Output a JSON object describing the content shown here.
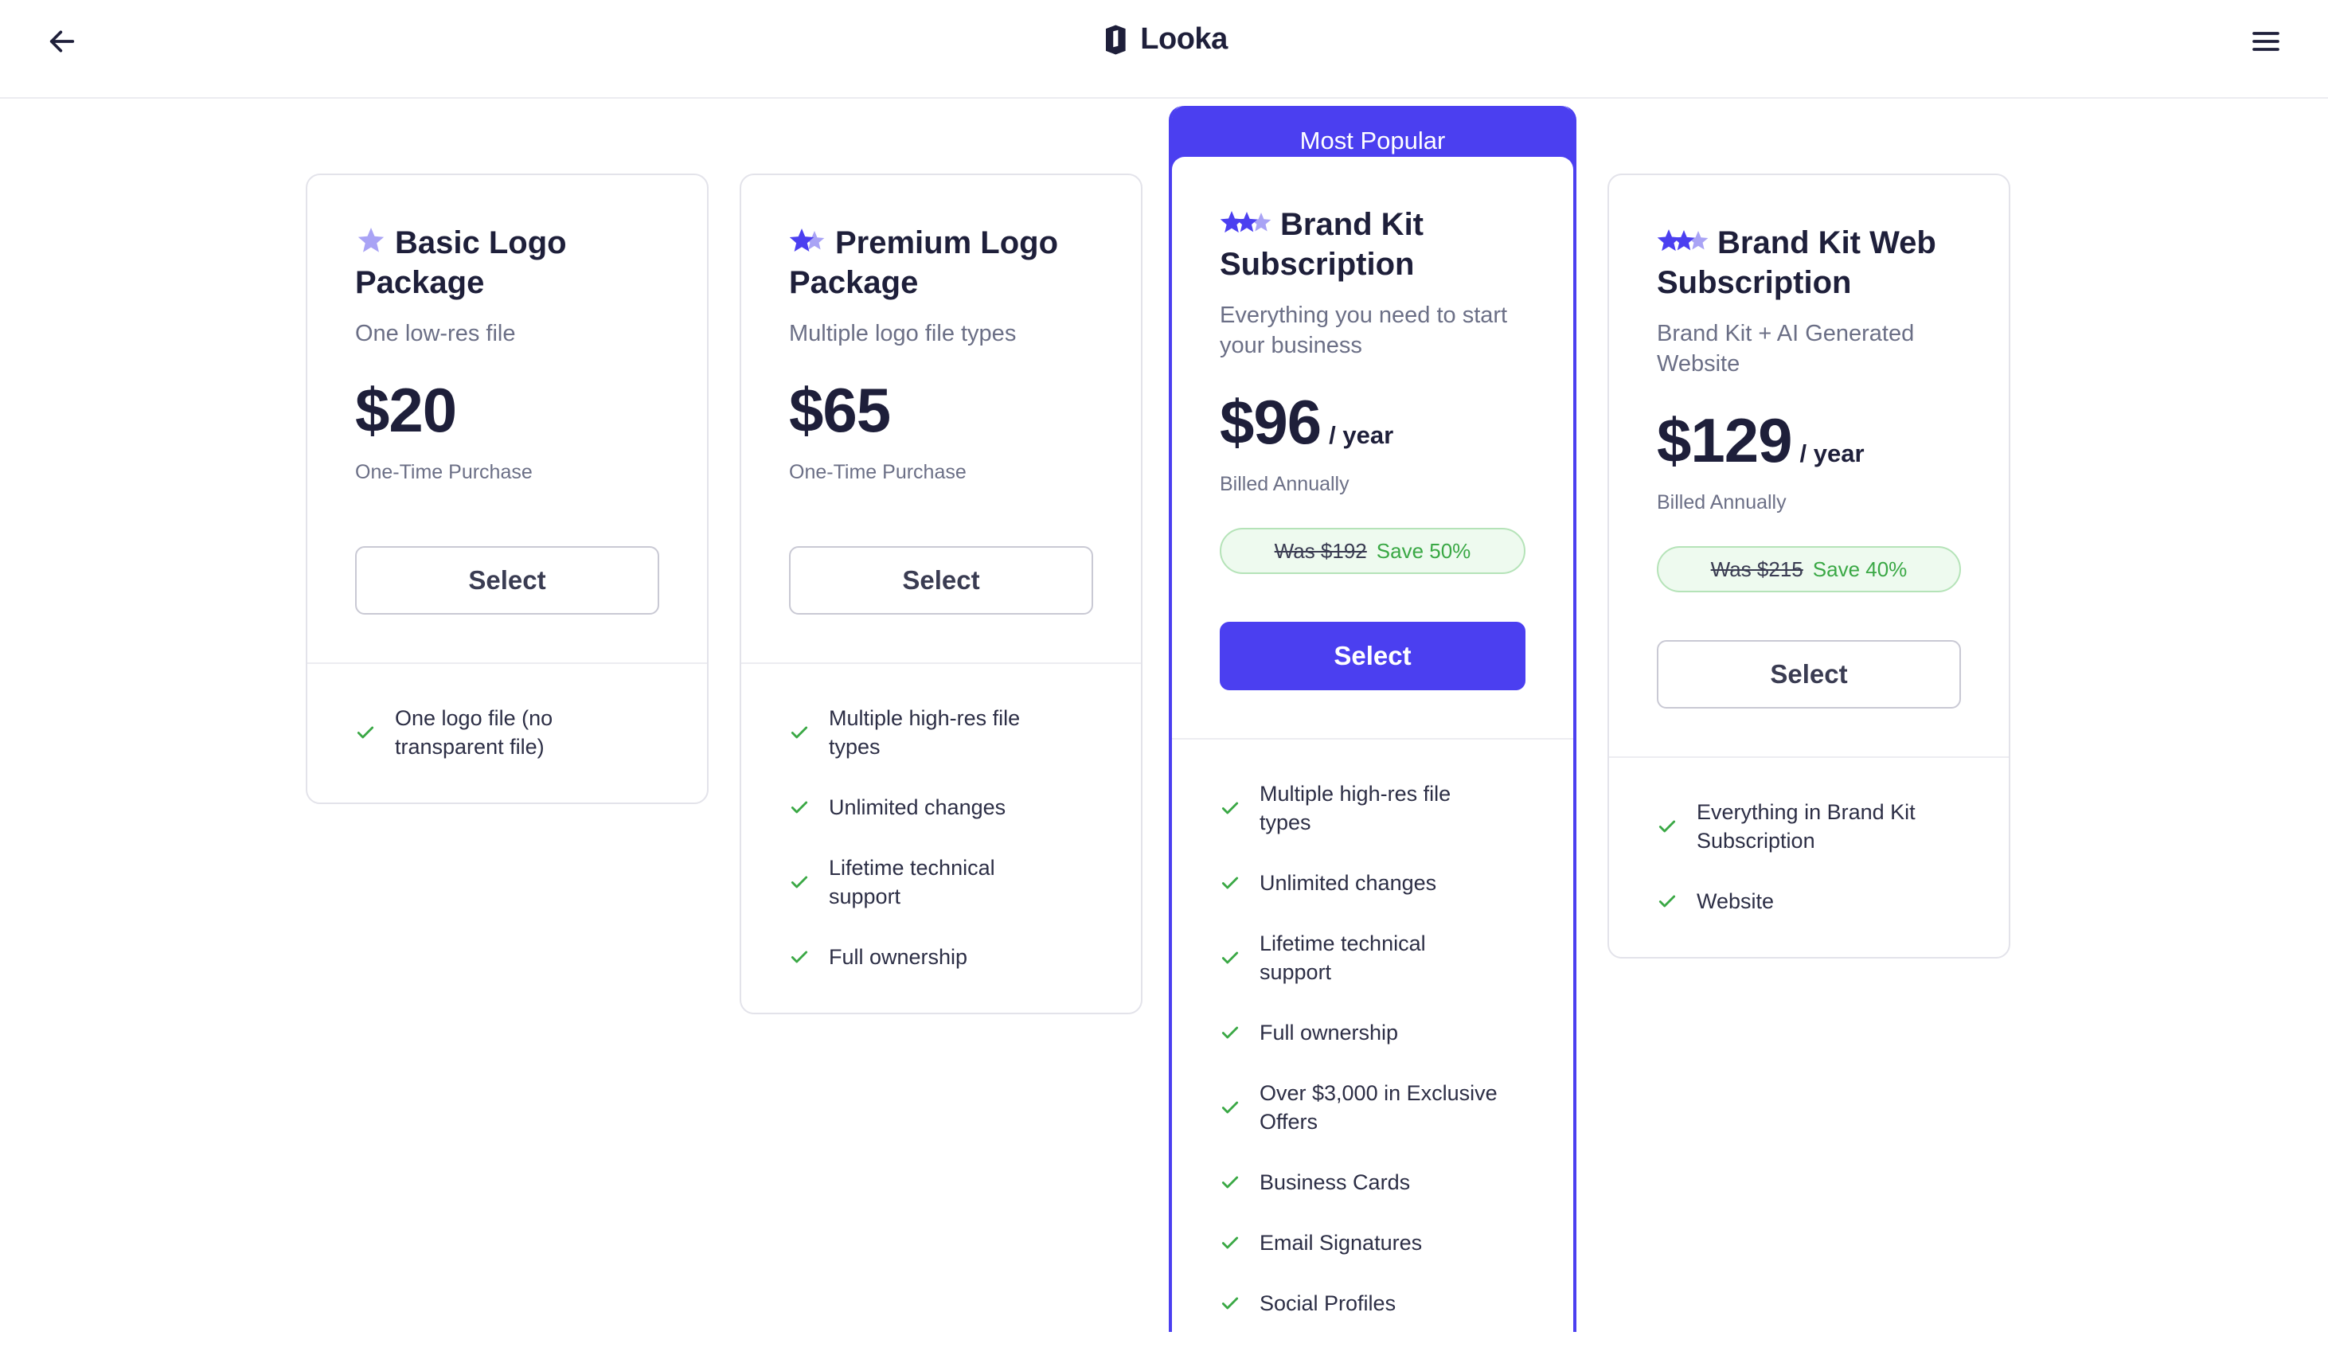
{
  "header": {
    "brand": "Looka",
    "back_icon": "arrow-left-icon",
    "menu_icon": "hamburger-menu-icon",
    "logo_icon": "looka-logo-icon"
  },
  "colors": {
    "accent": "#4b3ff0",
    "star_light": "#a9a3f5",
    "check": "#3aa845",
    "save_bg": "#eefaef"
  },
  "plans": [
    {
      "title": "Basic Logo Package",
      "stars": 1,
      "subtitle": "One low-res file",
      "price": "$20",
      "period": "",
      "billing": "One-Time Purchase",
      "select_label": "Select",
      "features": [
        "One logo file (no transparent file)"
      ]
    },
    {
      "title": "Premium Logo Package",
      "stars": 2,
      "subtitle": "Multiple logo file types",
      "price": "$65",
      "period": "",
      "billing": "One-Time Purchase",
      "select_label": "Select",
      "features": [
        "Multiple high-res file types",
        "Unlimited changes",
        "Lifetime technical support",
        "Full ownership"
      ]
    },
    {
      "badge": "Most Popular",
      "title": "Brand Kit Subscription",
      "stars": 3,
      "subtitle": "Everything you need to start your business",
      "price": "$96",
      "period": "/ year",
      "billing": "Billed Annually",
      "was": "Was $192",
      "save": "Save 50%",
      "select_label": "Select",
      "features": [
        "Multiple high-res file types",
        "Unlimited changes",
        "Lifetime technical support",
        "Full ownership",
        "Over $3,000 in Exclusive Offers",
        "Business Cards",
        "Email Signatures",
        "Social Profiles"
      ]
    },
    {
      "title": "Brand Kit Web Subscription",
      "stars": 3,
      "subtitle": "Brand Kit + AI Generated Website",
      "price": "$129",
      "period": "/ year",
      "billing": "Billed Annually",
      "was": "Was $215",
      "save": "Save 40%",
      "select_label": "Select",
      "features": [
        "Everything in Brand Kit Subscription",
        "Website"
      ]
    }
  ]
}
